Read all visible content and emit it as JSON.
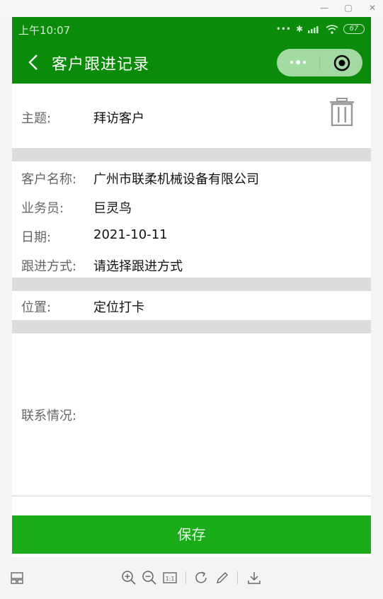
{
  "status_bar": {
    "time": "上午10:07",
    "battery": "67"
  },
  "nav": {
    "title": "客户跟进记录"
  },
  "form": {
    "subject_label": "主题:",
    "subject_value": "拜访客户",
    "customer_label": "客户名称:",
    "customer_value": "广州市联柔机械设备有限公司",
    "salesperson_label": "业务员:",
    "salesperson_value": "巨灵鸟",
    "date_label": "日期:",
    "date_value": "2021-10-11",
    "method_label": "跟进方式:",
    "method_value": "请选择跟进方式",
    "location_label": "位置:",
    "location_value": "定位打卡",
    "contact_label": "联系情况:"
  },
  "actions": {
    "save_label": "保存"
  },
  "colors": {
    "brand_green": "#0a8c0a",
    "save_green": "#1aad19"
  },
  "icons": [
    "back-icon",
    "more-icon",
    "target-icon",
    "trash-icon",
    "zoom-in-icon",
    "zoom-out-icon",
    "actual-size-icon",
    "rotate-icon",
    "edit-icon",
    "download-icon",
    "layout-icon"
  ]
}
